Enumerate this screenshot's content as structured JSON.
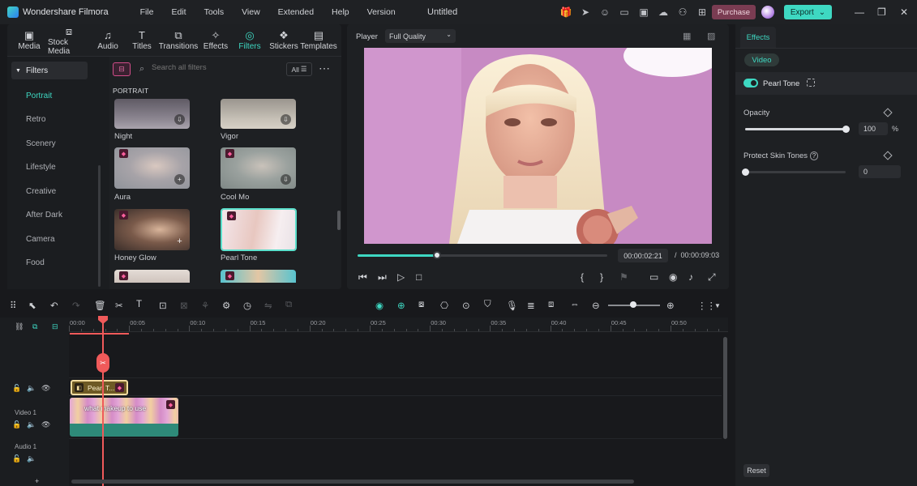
{
  "app": {
    "name": "Wondershare Filmora",
    "doc_title": "Untitled"
  },
  "menu": [
    "File",
    "Edit",
    "Tools",
    "View",
    "Extended",
    "Help",
    "Version"
  ],
  "titlebar": {
    "purchase_label": "Purchase",
    "export_label": "Export"
  },
  "media_tabs": [
    {
      "label": "Media",
      "icon": "media-icon"
    },
    {
      "label": "Stock Media",
      "icon": "stock-media-icon"
    },
    {
      "label": "Audio",
      "icon": "audio-icon"
    },
    {
      "label": "Titles",
      "icon": "titles-icon"
    },
    {
      "label": "Transitions",
      "icon": "transitions-icon"
    },
    {
      "label": "Effects",
      "icon": "effects-icon"
    },
    {
      "label": "Filters",
      "icon": "filters-icon",
      "active": true
    },
    {
      "label": "Stickers",
      "icon": "stickers-icon"
    },
    {
      "label": "Templates",
      "icon": "templates-icon"
    }
  ],
  "filters_sidebar": {
    "header": "Filters",
    "items": [
      "Portrait",
      "Retro",
      "Scenery",
      "Lifestyle",
      "Creative",
      "After Dark",
      "Camera",
      "Food"
    ],
    "active": "Portrait"
  },
  "search": {
    "placeholder": "Search all filters",
    "all_label": "All"
  },
  "filter_section": "PORTRAIT",
  "filter_thumbs": [
    "Night",
    "Vigor",
    "Aura",
    "Cool Mo",
    "Honey Glow",
    "Pearl Tone"
  ],
  "player": {
    "label": "Player",
    "quality": "Full Quality",
    "current_time": "00:00:02:21",
    "separator": "/",
    "total_time": "00:00:09:03",
    "progress": 0.31
  },
  "effects_panel": {
    "tab": "Effects",
    "pill": "Video",
    "effect_name": "Pearl Tone",
    "opacity_label": "Opacity",
    "opacity_value": "100",
    "opacity_unit": "%",
    "opacity_level": 1.0,
    "protect_label": "Protect Skin Tones",
    "protect_value": "0",
    "protect_level": 0.0,
    "reset_label": "Reset"
  },
  "timeline": {
    "ruler": [
      "00:00",
      "00:05",
      "00:10",
      "00:15",
      "00:20",
      "00:25",
      "00:30",
      "00:35",
      "00:40",
      "00:45",
      "00:50"
    ],
    "effect_clip": "Pearl T...",
    "video_clip": "what makeup to use",
    "track_video": "Video 1",
    "track_audio": "Audio 1"
  },
  "colors": {
    "accent": "#3ed8c2",
    "playhead": "#f05a5a",
    "premium": "#ff5f9e"
  }
}
